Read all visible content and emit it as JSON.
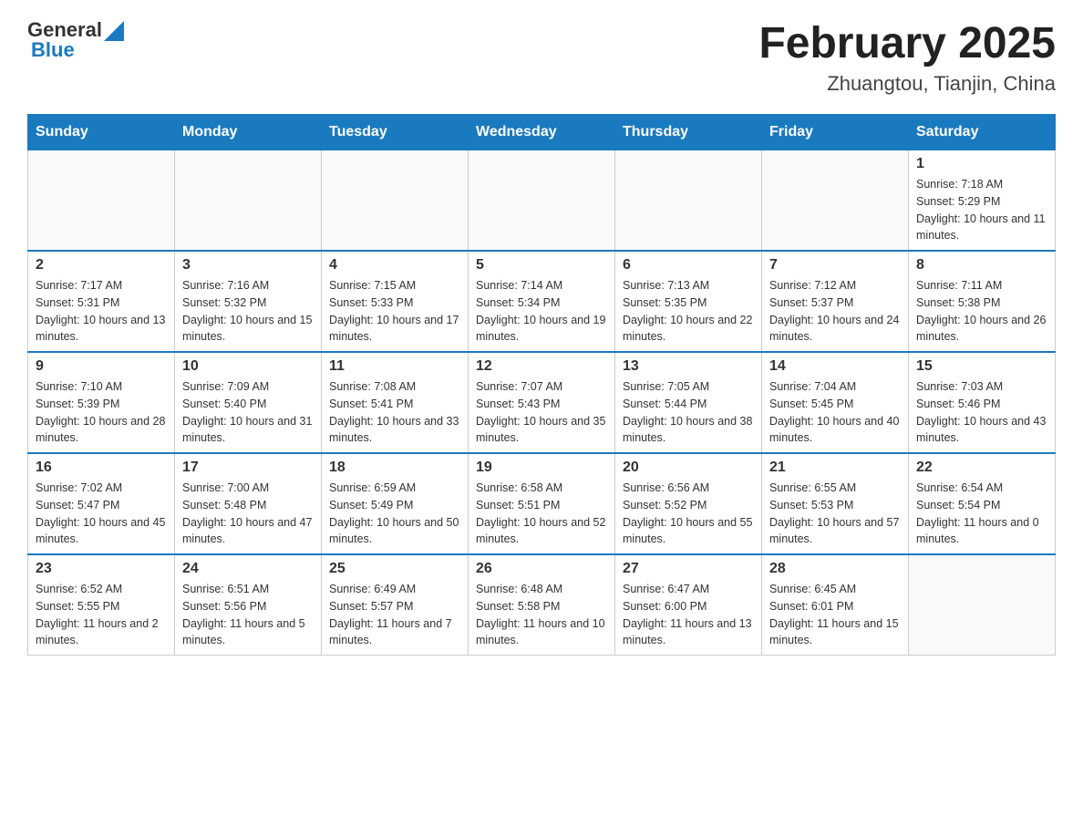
{
  "header": {
    "logo_general": "General",
    "logo_blue": "Blue",
    "title": "February 2025",
    "subtitle": "Zhuangtou, Tianjin, China"
  },
  "weekdays": [
    "Sunday",
    "Monday",
    "Tuesday",
    "Wednesday",
    "Thursday",
    "Friday",
    "Saturday"
  ],
  "weeks": [
    [
      {
        "day": "",
        "info": ""
      },
      {
        "day": "",
        "info": ""
      },
      {
        "day": "",
        "info": ""
      },
      {
        "day": "",
        "info": ""
      },
      {
        "day": "",
        "info": ""
      },
      {
        "day": "",
        "info": ""
      },
      {
        "day": "1",
        "info": "Sunrise: 7:18 AM\nSunset: 5:29 PM\nDaylight: 10 hours and 11 minutes."
      }
    ],
    [
      {
        "day": "2",
        "info": "Sunrise: 7:17 AM\nSunset: 5:31 PM\nDaylight: 10 hours and 13 minutes."
      },
      {
        "day": "3",
        "info": "Sunrise: 7:16 AM\nSunset: 5:32 PM\nDaylight: 10 hours and 15 minutes."
      },
      {
        "day": "4",
        "info": "Sunrise: 7:15 AM\nSunset: 5:33 PM\nDaylight: 10 hours and 17 minutes."
      },
      {
        "day": "5",
        "info": "Sunrise: 7:14 AM\nSunset: 5:34 PM\nDaylight: 10 hours and 19 minutes."
      },
      {
        "day": "6",
        "info": "Sunrise: 7:13 AM\nSunset: 5:35 PM\nDaylight: 10 hours and 22 minutes."
      },
      {
        "day": "7",
        "info": "Sunrise: 7:12 AM\nSunset: 5:37 PM\nDaylight: 10 hours and 24 minutes."
      },
      {
        "day": "8",
        "info": "Sunrise: 7:11 AM\nSunset: 5:38 PM\nDaylight: 10 hours and 26 minutes."
      }
    ],
    [
      {
        "day": "9",
        "info": "Sunrise: 7:10 AM\nSunset: 5:39 PM\nDaylight: 10 hours and 28 minutes."
      },
      {
        "day": "10",
        "info": "Sunrise: 7:09 AM\nSunset: 5:40 PM\nDaylight: 10 hours and 31 minutes."
      },
      {
        "day": "11",
        "info": "Sunrise: 7:08 AM\nSunset: 5:41 PM\nDaylight: 10 hours and 33 minutes."
      },
      {
        "day": "12",
        "info": "Sunrise: 7:07 AM\nSunset: 5:43 PM\nDaylight: 10 hours and 35 minutes."
      },
      {
        "day": "13",
        "info": "Sunrise: 7:05 AM\nSunset: 5:44 PM\nDaylight: 10 hours and 38 minutes."
      },
      {
        "day": "14",
        "info": "Sunrise: 7:04 AM\nSunset: 5:45 PM\nDaylight: 10 hours and 40 minutes."
      },
      {
        "day": "15",
        "info": "Sunrise: 7:03 AM\nSunset: 5:46 PM\nDaylight: 10 hours and 43 minutes."
      }
    ],
    [
      {
        "day": "16",
        "info": "Sunrise: 7:02 AM\nSunset: 5:47 PM\nDaylight: 10 hours and 45 minutes."
      },
      {
        "day": "17",
        "info": "Sunrise: 7:00 AM\nSunset: 5:48 PM\nDaylight: 10 hours and 47 minutes."
      },
      {
        "day": "18",
        "info": "Sunrise: 6:59 AM\nSunset: 5:49 PM\nDaylight: 10 hours and 50 minutes."
      },
      {
        "day": "19",
        "info": "Sunrise: 6:58 AM\nSunset: 5:51 PM\nDaylight: 10 hours and 52 minutes."
      },
      {
        "day": "20",
        "info": "Sunrise: 6:56 AM\nSunset: 5:52 PM\nDaylight: 10 hours and 55 minutes."
      },
      {
        "day": "21",
        "info": "Sunrise: 6:55 AM\nSunset: 5:53 PM\nDaylight: 10 hours and 57 minutes."
      },
      {
        "day": "22",
        "info": "Sunrise: 6:54 AM\nSunset: 5:54 PM\nDaylight: 11 hours and 0 minutes."
      }
    ],
    [
      {
        "day": "23",
        "info": "Sunrise: 6:52 AM\nSunset: 5:55 PM\nDaylight: 11 hours and 2 minutes."
      },
      {
        "day": "24",
        "info": "Sunrise: 6:51 AM\nSunset: 5:56 PM\nDaylight: 11 hours and 5 minutes."
      },
      {
        "day": "25",
        "info": "Sunrise: 6:49 AM\nSunset: 5:57 PM\nDaylight: 11 hours and 7 minutes."
      },
      {
        "day": "26",
        "info": "Sunrise: 6:48 AM\nSunset: 5:58 PM\nDaylight: 11 hours and 10 minutes."
      },
      {
        "day": "27",
        "info": "Sunrise: 6:47 AM\nSunset: 6:00 PM\nDaylight: 11 hours and 13 minutes."
      },
      {
        "day": "28",
        "info": "Sunrise: 6:45 AM\nSunset: 6:01 PM\nDaylight: 11 hours and 15 minutes."
      },
      {
        "day": "",
        "info": ""
      }
    ]
  ]
}
